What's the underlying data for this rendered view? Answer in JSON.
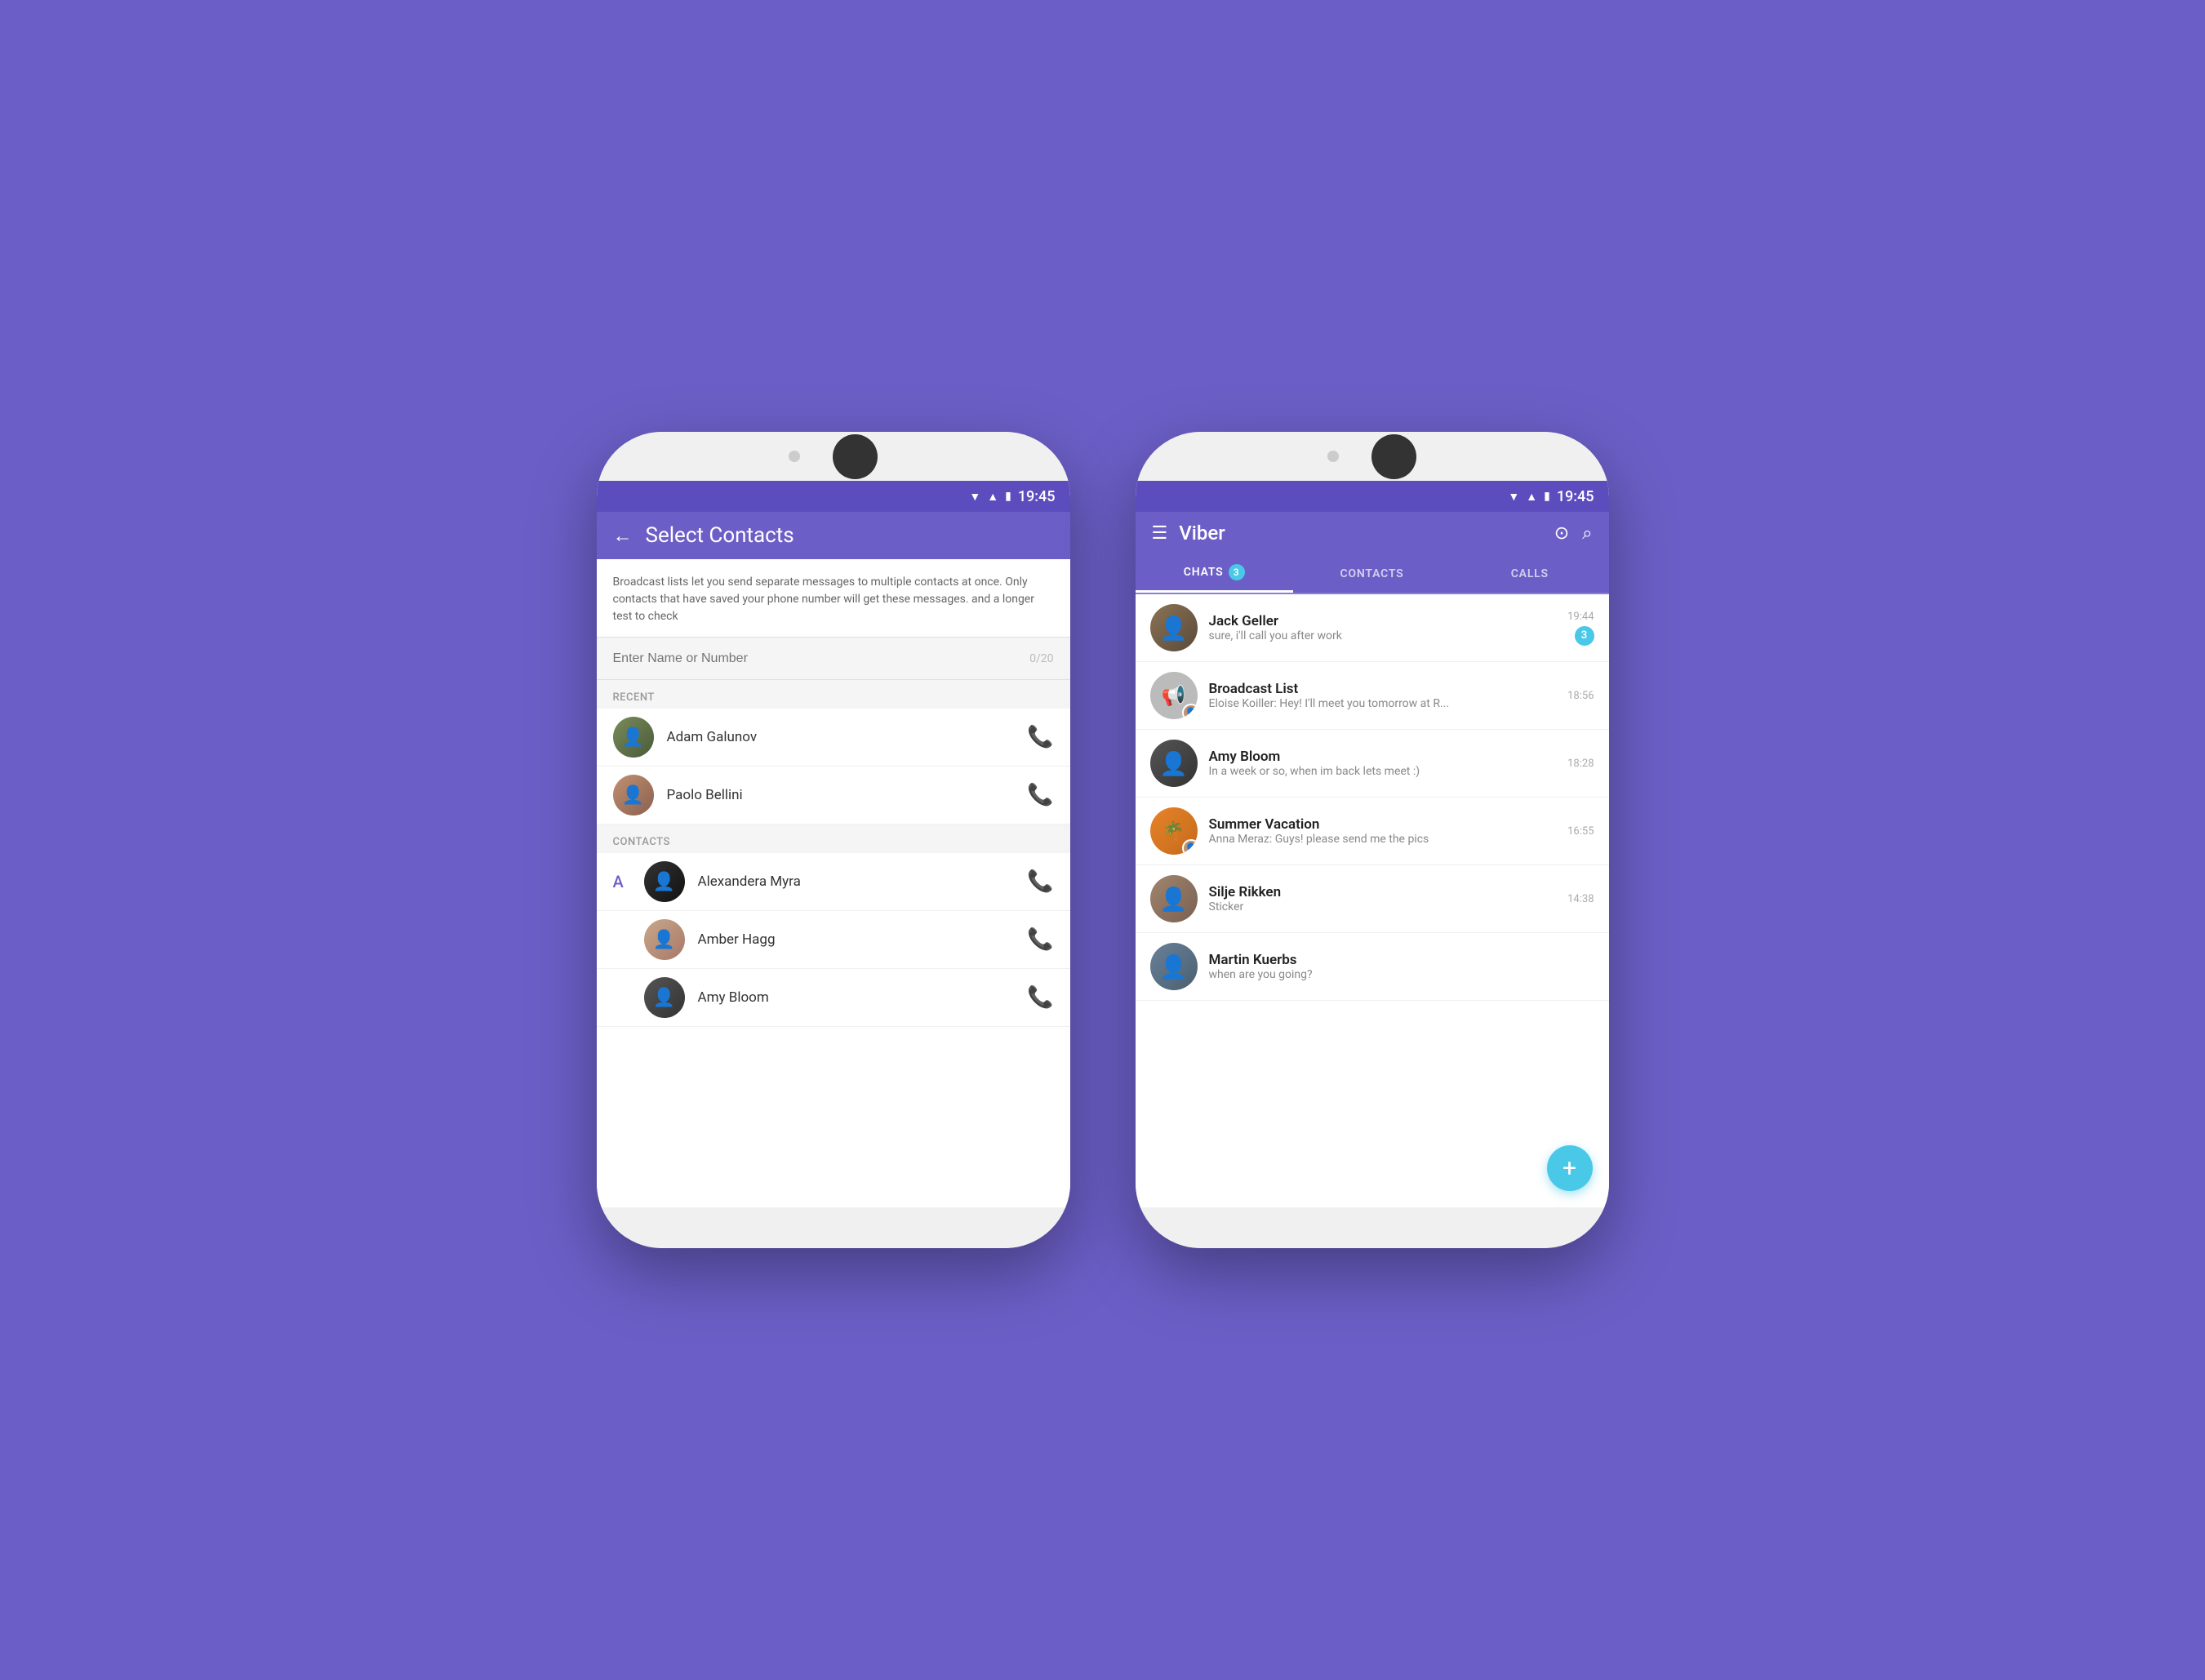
{
  "phone1": {
    "statusBar": {
      "time": "19:45"
    },
    "header": {
      "backLabel": "←",
      "title": "Select Contacts"
    },
    "broadcastInfo": "Broadcast lists let you send separate messages to multiple contacts at once. Only contacts that have saved your phone number will get these messages. and a longer test to check",
    "searchPlaceholder": "Enter Name or Number",
    "searchCounter": "0/20",
    "recentSection": "RECENT",
    "recentContacts": [
      {
        "name": "Adam Galunov",
        "avatarClass": "av-adam"
      },
      {
        "name": "Paolo Bellini",
        "avatarClass": "av-paolo"
      }
    ],
    "contactsSection": "CONTACTS",
    "contactsLetter": "A",
    "contacts": [
      {
        "name": "Alexandera Myra",
        "avatarClass": "av-alexandera"
      },
      {
        "name": "Amber Hagg",
        "avatarClass": "av-amber"
      },
      {
        "name": "Amy Bloom",
        "avatarClass": "av-amy2"
      }
    ]
  },
  "phone2": {
    "statusBar": {
      "time": "19:45"
    },
    "header": {
      "menuLabel": "☰",
      "title": "Viber",
      "iconQr": "⊙",
      "iconSearch": "⌕"
    },
    "tabs": [
      {
        "label": "CHATS",
        "badge": "3",
        "active": true
      },
      {
        "label": "CONTACTS",
        "badge": null,
        "active": false
      },
      {
        "label": "CALLS",
        "badge": null,
        "active": false
      }
    ],
    "chats": [
      {
        "name": "Jack Geller",
        "message": "sure, i'll call you after work",
        "time": "19:44",
        "unread": "3",
        "avatarClass": "av-jack"
      },
      {
        "name": "Broadcast List",
        "message": "Eloise Koiller: Hey! I'll meet you tomorrow at R...",
        "time": "18:56",
        "unread": null,
        "avatarClass": "av-broadcast",
        "isBroadcast": true
      },
      {
        "name": "Amy Bloom",
        "message": "In a week or so, when im back lets meet :)",
        "time": "18:28",
        "unread": null,
        "avatarClass": "av-amy"
      },
      {
        "name": "Summer Vacation",
        "message": "Anna Meraz: Guys! please send me the pics",
        "time": "16:55",
        "unread": null,
        "avatarClass": "av-summer"
      },
      {
        "name": "Silje Rikken",
        "message": "Sticker",
        "time": "14:38",
        "unread": null,
        "avatarClass": "av-silje"
      },
      {
        "name": "Martin Kuerbs",
        "message": "when are you going?",
        "time": null,
        "unread": null,
        "avatarClass": "av-martin"
      }
    ],
    "fabLabel": "+"
  }
}
